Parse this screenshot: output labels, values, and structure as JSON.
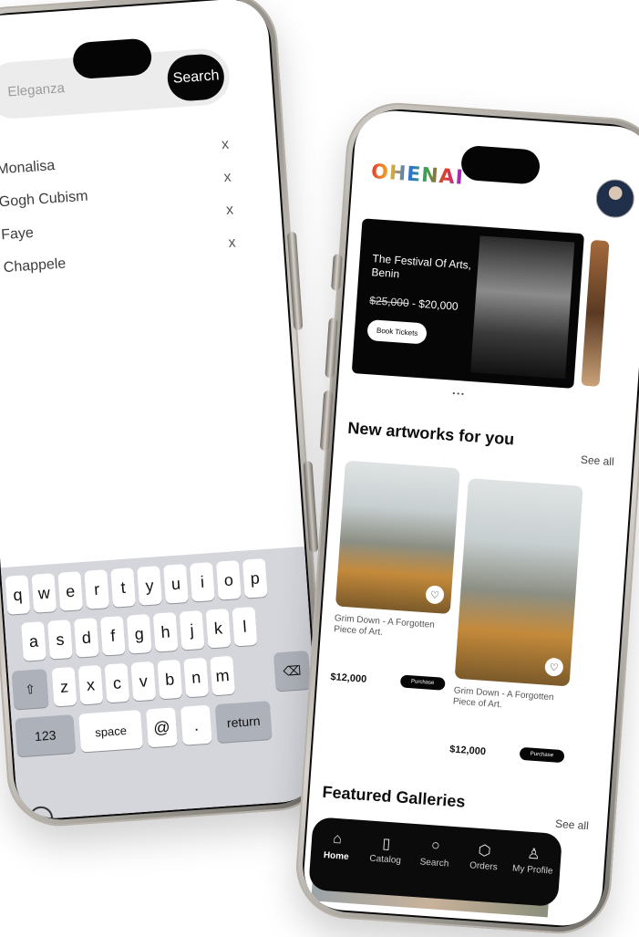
{
  "left_phone": {
    "search": {
      "placeholder": "Eleganza",
      "button_label": "Search"
    },
    "history": [
      {
        "label": "Monalisa",
        "close": "x"
      },
      {
        "label": "Gogh Cubism",
        "close": "x"
      },
      {
        "label": "Faye",
        "close": "x"
      },
      {
        "label": "Chappele",
        "close": "x"
      }
    ],
    "keyboard": {
      "row1": [
        "q",
        "w",
        "e",
        "r",
        "t",
        "y",
        "u",
        "i",
        "o",
        "p"
      ],
      "row2": [
        "a",
        "s",
        "d",
        "f",
        "g",
        "h",
        "j",
        "k",
        "l"
      ],
      "row3": [
        "z",
        "x",
        "c",
        "v",
        "b",
        "n",
        "m"
      ],
      "shift": "⇧",
      "delete": "⌫",
      "numbers": "123",
      "space": "space",
      "at": "@",
      "dot": ".",
      "return": "return",
      "emoji": "☺"
    }
  },
  "right_phone": {
    "logo": "OHENAI",
    "banner": {
      "title": "The Festival Of Arts, Benin",
      "old_price": "$25,000",
      "separator": " - ",
      "price": "$20,000",
      "button": "Book Tickets"
    },
    "carousel_dots": "•••",
    "new_artworks": {
      "title": "New artworks for you",
      "see_all": "See all",
      "cards": [
        {
          "title": "Grim Down - A Forgotten Piece of Art.",
          "price": "$12,000",
          "button": "Purchase",
          "heart": "♡"
        },
        {
          "title": "Grim Down - A Forgotten Piece of Art.",
          "price": "$12,000",
          "button": "Purchase",
          "heart": "♡"
        }
      ]
    },
    "featured": {
      "title": "Featured Galleries",
      "see_all": "See all"
    },
    "tabs": [
      {
        "label": "Home",
        "icon": "⌂"
      },
      {
        "label": "Catalog",
        "icon": "▯"
      },
      {
        "label": "Search",
        "icon": "○"
      },
      {
        "label": "Orders",
        "icon": "⬡"
      },
      {
        "label": "My Profile",
        "icon": "♙"
      }
    ]
  }
}
